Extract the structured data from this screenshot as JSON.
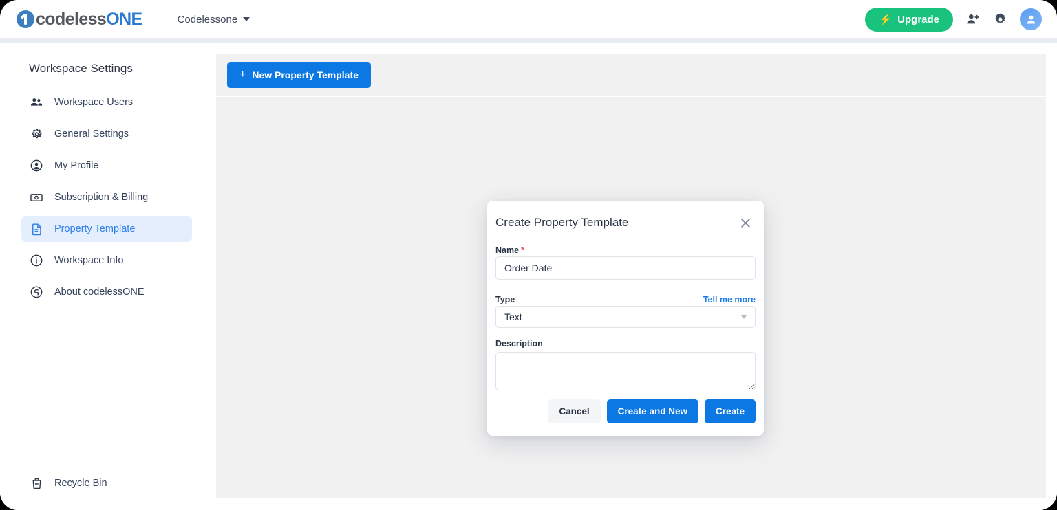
{
  "header": {
    "logo_text_dark": "codeless",
    "logo_text_blue": "ONE",
    "workspace_name": "Codelessone",
    "upgrade_label": "Upgrade",
    "bolt_icon": "lightning-bolt-icon",
    "add_user_icon": "add-user-icon",
    "settings_icon": "gear-icon",
    "avatar_icon": "user-avatar-icon",
    "accent_green": "#19c37d"
  },
  "sidebar": {
    "title": "Workspace Settings",
    "items": [
      {
        "label": "Workspace Users",
        "icon": "users-group-icon",
        "active": false
      },
      {
        "label": "General Settings",
        "icon": "gear-icon",
        "active": false
      },
      {
        "label": "My Profile",
        "icon": "user-circle-icon",
        "active": false
      },
      {
        "label": "Subscription & Billing",
        "icon": "banknote-icon",
        "active": false
      },
      {
        "label": "Property Template",
        "icon": "document-icon",
        "active": true
      },
      {
        "label": "Workspace Info",
        "icon": "info-circle-icon",
        "active": false
      },
      {
        "label": "About codelessONE",
        "icon": "about-circle-icon",
        "active": false
      }
    ],
    "recycle_bin": {
      "label": "Recycle Bin",
      "icon": "recycle-bin-icon"
    },
    "active_bg": "#e5eefc",
    "active_color": "#2f80ed"
  },
  "toolbar": {
    "new_template_label": "New Property Template",
    "plus_icon": "plus-icon",
    "button_color": "#0b78e3"
  },
  "modal": {
    "title": "Create Property Template",
    "close_icon": "close-icon",
    "name": {
      "label": "Name",
      "required_marker": "*",
      "value": "Order Date",
      "placeholder": ""
    },
    "type": {
      "label": "Type",
      "selected": "Text",
      "caret_icon": "chevron-down-icon",
      "tell_me_more": "Tell me more"
    },
    "description": {
      "label": "Description",
      "value": "",
      "placeholder": ""
    },
    "buttons": {
      "cancel": "Cancel",
      "create_and_new": "Create and New",
      "create": "Create"
    }
  },
  "annotation": {
    "arrow_icon": "curved-arrow-icon",
    "arrow_color": "#0f3d8c"
  }
}
